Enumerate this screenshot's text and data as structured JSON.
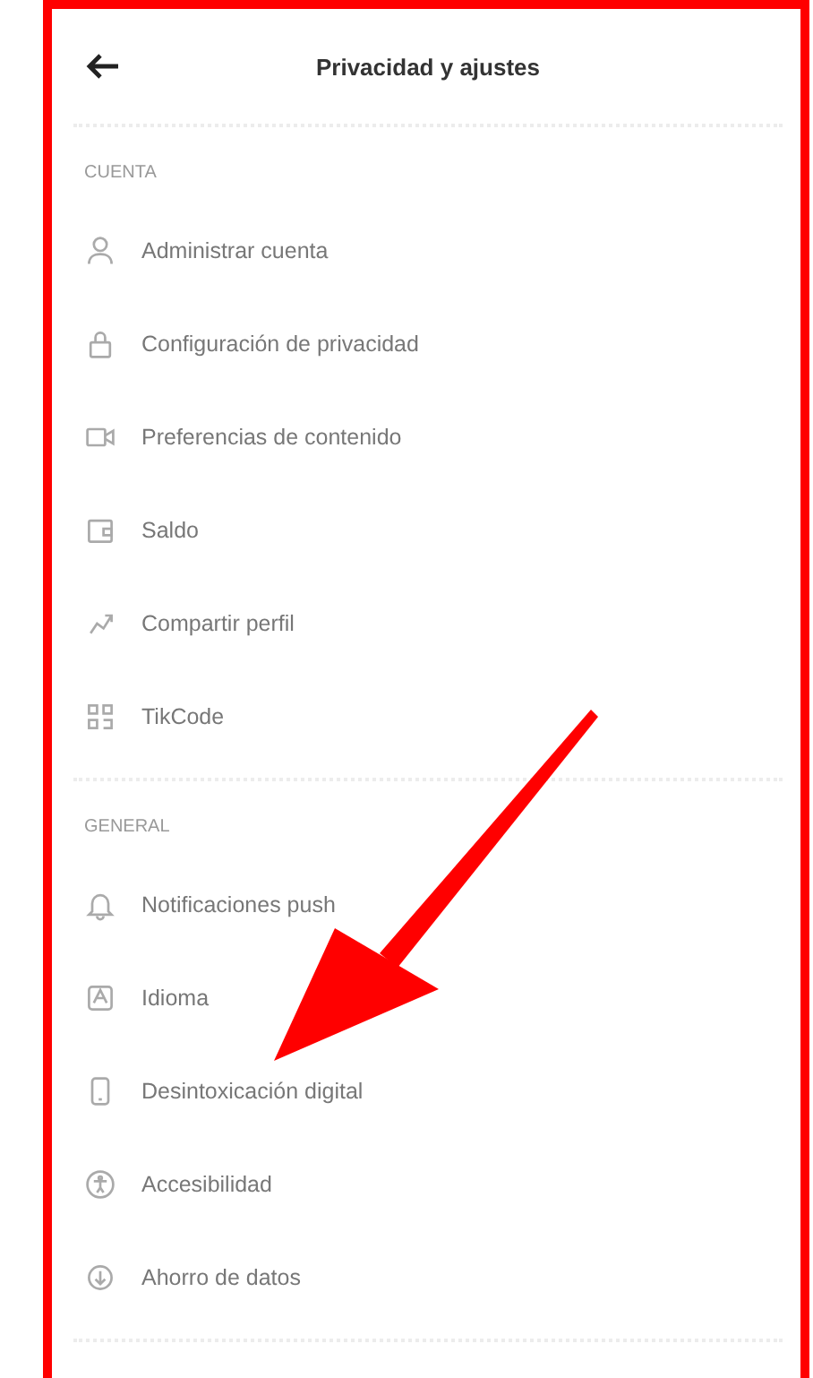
{
  "header": {
    "title": "Privacidad y ajustes"
  },
  "sections": [
    {
      "heading": "CUENTA",
      "items": [
        {
          "label": "Administrar cuenta"
        },
        {
          "label": "Configuración de privacidad"
        },
        {
          "label": "Preferencias de contenido"
        },
        {
          "label": "Saldo"
        },
        {
          "label": "Compartir perfil"
        },
        {
          "label": "TikCode"
        }
      ]
    },
    {
      "heading": "GENERAL",
      "items": [
        {
          "label": "Notificaciones push"
        },
        {
          "label": "Idioma"
        },
        {
          "label": "Desintoxicación digital"
        },
        {
          "label": "Accesibilidad"
        },
        {
          "label": "Ahorro de datos"
        }
      ]
    }
  ]
}
